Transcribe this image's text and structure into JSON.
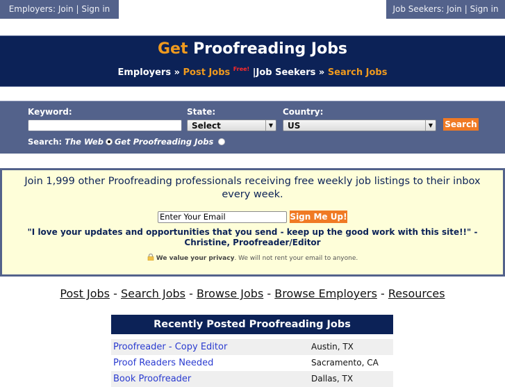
{
  "topbar": {
    "employers": {
      "prefix": "Employers:",
      "join": "Join",
      "sep": "|",
      "signin": "Sign in"
    },
    "jobseekers": {
      "prefix": "Job Seekers:",
      "join": "Join",
      "sep": "|",
      "signin": "Sign in"
    }
  },
  "header": {
    "title_accent": "Get",
    "title_rest": "Proofreading Jobs",
    "subnav": {
      "employers": "Employers »",
      "post_jobs": "Post Jobs",
      "free_badge": "Free!",
      "divider": "|",
      "job_seekers": "Job Seekers »",
      "search_jobs": "Search Jobs"
    }
  },
  "search": {
    "keyword_label": "Keyword:",
    "keyword_value": "",
    "state_label": "State:",
    "state_value": "Select",
    "country_label": "Country:",
    "country_value": "US",
    "search_button": "Search",
    "scope_label": "Search:",
    "scope_options": [
      {
        "label": "The Web",
        "checked": true
      },
      {
        "label": "Get Proofreading Jobs",
        "checked": false
      }
    ]
  },
  "signup": {
    "pitch": "Join 1,999 other Proofreading professionals receiving free weekly job listings to their inbox every week.",
    "email_value": "Enter Your Email",
    "button": "Sign Me Up!",
    "quote": "\"I love your updates and opportunities that you send - keep up the good work with this site!!\" - Christine, Proofreader/Editor",
    "privacy_bold": "We value your privacy",
    "privacy_rest": ". We will not rent your email to anyone."
  },
  "links": [
    {
      "label": "Post Jobs"
    },
    {
      "label": "Search Jobs"
    },
    {
      "label": "Browse Jobs"
    },
    {
      "label": "Browse Employers"
    },
    {
      "label": "Resources"
    }
  ],
  "link_separator": " - ",
  "jobs": {
    "heading": "Recently Posted Proofreading Jobs",
    "rows": [
      {
        "title": "Proofreader - Copy Editor",
        "location": "Austin, TX"
      },
      {
        "title": "Proof Readers Needed",
        "location": "Sacramento, CA"
      },
      {
        "title": "Book Proofreader",
        "location": "Dallas, TX"
      }
    ]
  },
  "colors": {
    "nav_blue": "#53628b",
    "header_navy": "#0c2257",
    "accent_orange": "#f09a1e",
    "button_orange": "#f07a24",
    "signup_bg": "#fefed9",
    "job_link": "#2a3bd0"
  }
}
